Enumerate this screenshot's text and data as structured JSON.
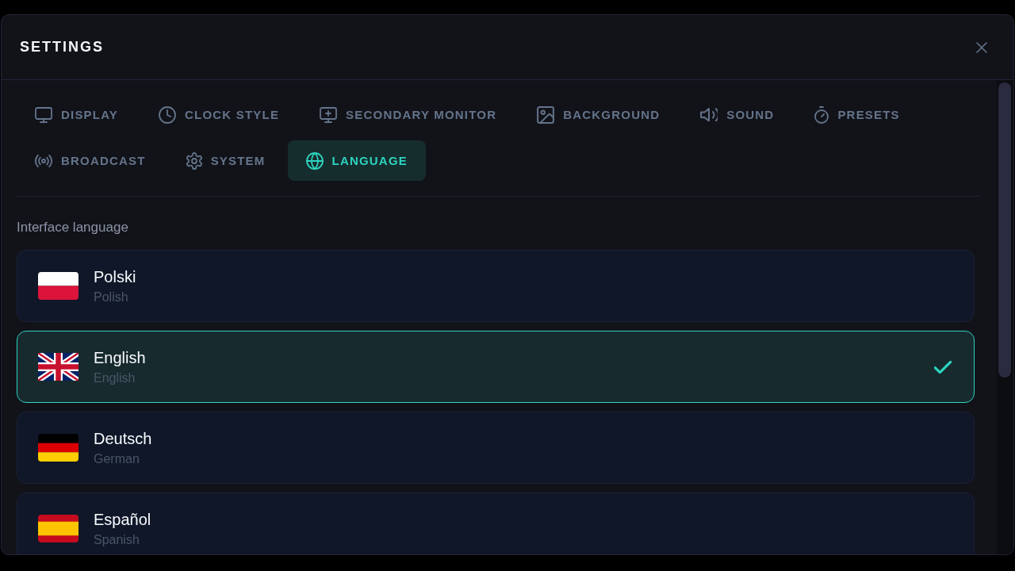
{
  "dialog": {
    "title": "SETTINGS"
  },
  "tabs": [
    {
      "label": "DISPLAY",
      "kind": "monitor",
      "selected": false
    },
    {
      "label": "CLOCK STYLE",
      "kind": "clock",
      "selected": false
    },
    {
      "label": "SECONDARY MONITOR",
      "kind": "monitor-plus",
      "selected": false
    },
    {
      "label": "BACKGROUND",
      "kind": "image",
      "selected": false
    },
    {
      "label": "SOUND",
      "kind": "speaker",
      "selected": false
    },
    {
      "label": "PRESETS",
      "kind": "stopwatch",
      "selected": false
    },
    {
      "label": "BROADCAST",
      "kind": "broadcast",
      "selected": false
    },
    {
      "label": "SYSTEM",
      "kind": "gear",
      "selected": false
    },
    {
      "label": "LANGUAGE",
      "kind": "globe",
      "selected": true
    }
  ],
  "section": {
    "label": "Interface language"
  },
  "languages": [
    {
      "name": "Polski",
      "subtitle": "Polish",
      "kind": "pl",
      "selected": false
    },
    {
      "name": "English",
      "subtitle": "English",
      "kind": "gb",
      "selected": true
    },
    {
      "name": "Deutsch",
      "subtitle": "German",
      "kind": "de",
      "selected": false
    },
    {
      "name": "Español",
      "subtitle": "Spanish",
      "kind": "es",
      "selected": false
    }
  ]
}
